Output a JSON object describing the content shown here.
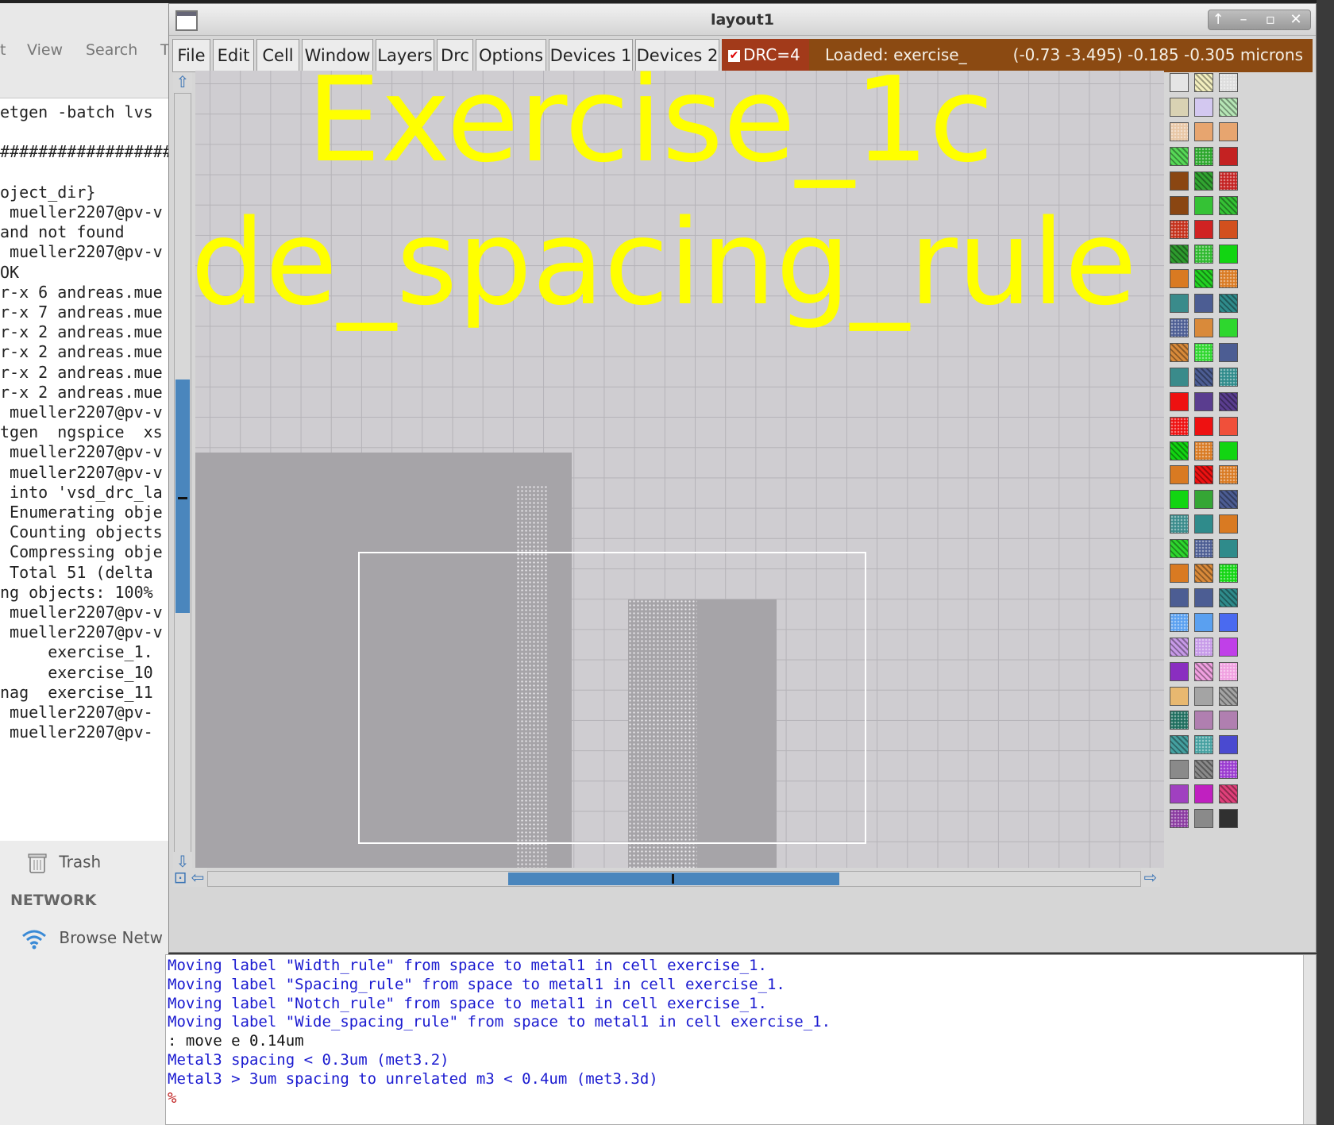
{
  "desktop": {
    "files_menu": [
      "t",
      "View",
      "Search",
      "T"
    ],
    "terminal_lines": [
      "etgen -batch lvs",
      "",
      "##################",
      "",
      "oject_dir}",
      " mueller2207@pv-v",
      "and not found",
      " mueller2207@pv-v",
      "OK",
      "r-x 6 andreas.mue",
      "r-x 7 andreas.mue",
      "r-x 2 andreas.mue",
      "r-x 2 andreas.mue",
      "r-x 2 andreas.mue",
      "r-x 2 andreas.mue",
      " mueller2207@pv-v",
      "tgen  ngspice  xs",
      " mueller2207@pv-v",
      " mueller2207@pv-v",
      " into 'vsd_drc_la",
      " Enumerating obje",
      " Counting objects",
      " Compressing obje",
      " Total 51 (delta",
      "ng objects: 100%",
      " mueller2207@pv-v",
      " mueller2207@pv-v",
      "     exercise_1.",
      "     exercise_10",
      "nag  exercise_11",
      " mueller2207@pv-",
      " mueller2207@pv-"
    ],
    "sidebar": {
      "trash": "Trash",
      "network_header": "NETWORK",
      "browse": "Browse Netw"
    }
  },
  "window": {
    "title": "layout1",
    "menu": [
      "File",
      "Edit",
      "Cell",
      "Window",
      "Layers",
      "Drc",
      "Options",
      "Devices 1",
      "Devices 2"
    ],
    "drc_label": "DRC=4",
    "drc_checked": true,
    "loaded": "Loaded: exercise_",
    "coords": "(-0.73 -3.495) -0.185 -0.305 microns"
  },
  "layout": {
    "label_top": "Exercise_1c",
    "label_bottom": "de_spacing_rule"
  },
  "console": {
    "lines": [
      {
        "text": "Moving label \"Width_rule\" from space to metal1 in cell exercise_1.",
        "style": "blue"
      },
      {
        "text": "Moving label \"Spacing_rule\" from space to metal1 in cell exercise_1.",
        "style": "blue"
      },
      {
        "text": "Moving label \"Notch_rule\" from space to metal1 in cell exercise_1.",
        "style": "blue"
      },
      {
        "text": "Moving label \"Wide_spacing_rule\" from space to metal1 in cell exercise_1.",
        "style": "blue"
      },
      {
        "text": ": move e 0.14um",
        "style": "cmd"
      },
      {
        "text": "Metal3 spacing < 0.3um (met3.2)",
        "style": "blue"
      },
      {
        "text": "Metal3 > 3um spacing to unrelated m3 < 0.4um (met3.3d)",
        "style": "blue"
      },
      {
        "text": "%",
        "style": "prompt"
      }
    ]
  },
  "colors": {
    "accent": "#4a86bd",
    "drc_bg": "#a23a1a",
    "status_bg": "#8b4a12",
    "label_yellow": "#ffff00",
    "metal": "#a6a4a8"
  },
  "palette": [
    [
      "#e5e5e5",
      "#f3efbf",
      "#dddddd"
    ],
    [
      "#d9d2b3",
      "#d3c8f0",
      "#b6e6b6"
    ],
    [
      "#e8c7a6",
      "#e7a56f",
      "#e7a56f"
    ],
    [
      "#57d957",
      "#2aa62a",
      "#c42222"
    ],
    [
      "#8a4612",
      "#31a531",
      "#c42222"
    ],
    [
      "#8a4612",
      "#35c235",
      "#35c235"
    ],
    [
      "#c4301a",
      "#d02222",
      "#d2501e"
    ],
    [
      "#2e9b2e",
      "#2eb92e",
      "#12d512"
    ],
    [
      "#d97a22",
      "#22d222",
      "#d97a22"
    ],
    [
      "#3a8b8b",
      "#4c5d93",
      "#2f8b8b"
    ],
    [
      "#4c5d93",
      "#d98a3a",
      "#2ed72e"
    ],
    [
      "#d98a3a",
      "#2ed72e",
      "#4c5d93"
    ],
    [
      "#3a8b8b",
      "#4c5d93",
      "#2f8b8b"
    ],
    [
      "#ee1111",
      "#5a3d8f",
      "#5a3d8f"
    ],
    [
      "#ee1111",
      "#ee1111",
      "#f0503a"
    ],
    [
      "#12d512",
      "#d97a22",
      "#12d512"
    ],
    [
      "#d97a22",
      "#ee1111",
      "#d97a22"
    ],
    [
      "#12d512",
      "#35a635",
      "#4c5d93"
    ],
    [
      "#3a8b8b",
      "#2f8b8b",
      "#d97a22"
    ],
    [
      "#2ed72e",
      "#4c5d93",
      "#2f8b8b"
    ],
    [
      "#d97a22",
      "#d98a3a",
      "#12d512"
    ],
    [
      "#4c5d93",
      "#4c5d93",
      "#2f8b8b"
    ],
    [
      "#5aa0f0",
      "#5aa0f0",
      "#4a6af0"
    ],
    [
      "#c79ae8",
      "#c79ae8",
      "#c040e8"
    ],
    [
      "#8a2ec0",
      "#f0a0e0",
      "#f0a0e0"
    ],
    [
      "#e8b870",
      "#a4a4a4",
      "#a4a4a4"
    ],
    [
      "#1e6e5e",
      "#b07fb0",
      "#b07fb0"
    ],
    [
      "#45a0a0",
      "#45a0a0",
      "#4a4ad0"
    ],
    [
      "#8a8a8a",
      "#8a8a8a",
      "#9a3ad0"
    ],
    [
      "#a040c0",
      "#c020c0",
      "#e0407a"
    ],
    [
      "#8a3aa0",
      "#8a8a8a",
      "#303030"
    ]
  ]
}
